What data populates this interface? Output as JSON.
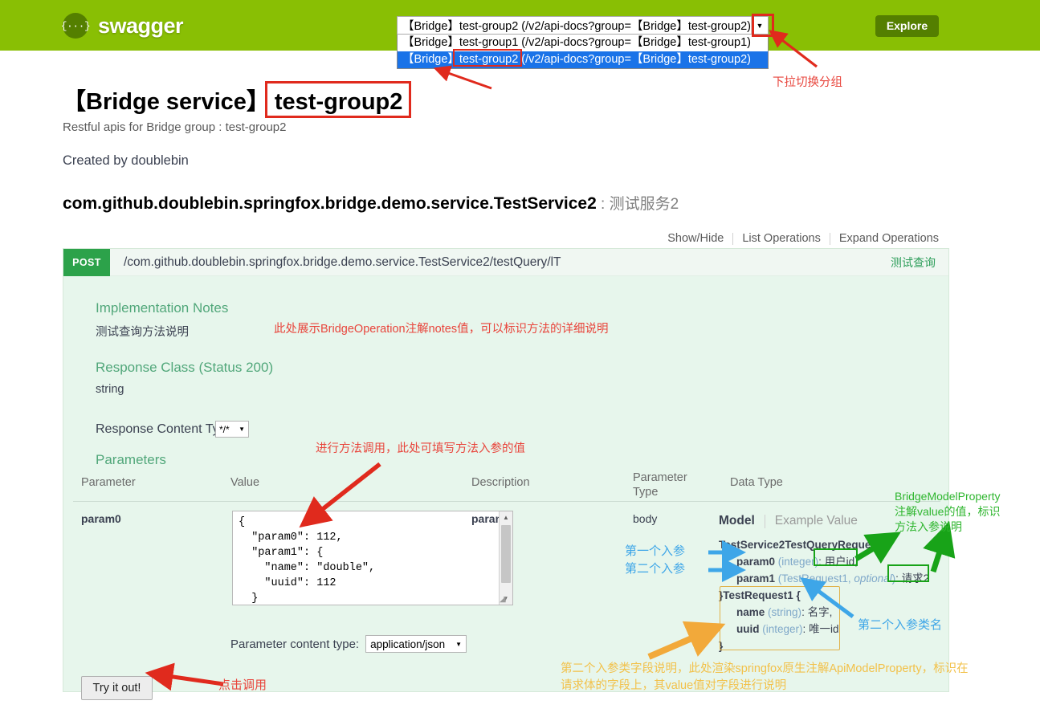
{
  "topbar": {
    "logo_text": "swagger",
    "logo_icon": "braces-icon",
    "explore_label": "Explore",
    "select_value": "【Bridge】test-group2 (/v2/api-docs?group=【Bridge】test-group2)",
    "select_arrow_icon": "chevron-down-icon",
    "options": [
      "【Bridge】test-group1 (/v2/api-docs?group=【Bridge】test-group1)",
      "【Bridge】test-group2 (/v2/api-docs?group=【Bridge】test-group2)"
    ],
    "selected_index": 1
  },
  "info": {
    "title_service": "【Bridge service】",
    "title_group": "test-group2",
    "description": "Restful apis for Bridge group : test-group2",
    "created_by": "Created by doublebin",
    "resource_name": "com.github.doublebin.springfox.bridge.demo.service.TestService2",
    "resource_cn": " : 测试服务2"
  },
  "op_options": {
    "show_hide": "Show/Hide",
    "list_operations": "List Operations",
    "expand_operations": "Expand Operations"
  },
  "operation": {
    "method": "POST",
    "path": "/com.github.doublebin.springfox.bridge.demo.service.TestService2/testQuery/lT",
    "summary": "测试查询",
    "impl_notes_title": "Implementation Notes",
    "impl_notes_text": "测试查询方法说明",
    "response_class_title": "Response Class (Status 200)",
    "response_class_text": "string",
    "response_content_type_label": "Response Content Type",
    "response_content_type_value": "*/*",
    "parameters_title": "Parameters",
    "columns": {
      "parameter": "Parameter",
      "value": "Value",
      "description": "Description",
      "parameter_type": "Parameter\nType",
      "data_type": "Data Type"
    },
    "row": {
      "parameter": "param0",
      "value": "{\n  \"param0\": 112,\n  \"param1\": {\n    \"name\": \"double\",\n    \"uuid\": 112\n  }\n}",
      "description": "param0",
      "parameter_type": "body"
    },
    "param_content_type_label": "Parameter content type:",
    "param_content_type_value": "application/json",
    "try_it_out": "Try it out!"
  },
  "model": {
    "tab_model": "Model",
    "tab_example": "Example Value",
    "class1_name": "TestService2TestQueryRequest {",
    "fields1": [
      {
        "name": "param0",
        "type": "(integer)",
        "optional": "",
        "desc": "用户id,"
      },
      {
        "name": "param1",
        "type": "(TestRequest1, ",
        "optional": "optional",
        "desc": "请求2"
      }
    ],
    "class2_name": "}TestRequest1 {",
    "fields2": [
      {
        "name": "name",
        "type": "(string)",
        "desc": "名字,"
      },
      {
        "name": "uuid",
        "type": "(integer)",
        "desc": "唯一id"
      }
    ],
    "close_brace": "}"
  },
  "annotations": {
    "dropdown_switch": "下拉切换分组",
    "notes_note": "此处展示BridgeOperation注解notes值，可以标识方法的详细说明",
    "params_note": "进行方法调用，此处可填写方法入参的值",
    "try_note": "点击调用",
    "first_param": "第一个入参",
    "second_param": "第二个入参",
    "bridge_model_note": "BridgeModelProperty\n注解value的值，标识\n方法入参说明",
    "second_class_note": "第二个入参类名",
    "field_note": "第二个入参类字段说明，此处渲染springfox原生注解ApiModelProperty，标识在\n请求体的字段上，其value值对字段进行说明"
  },
  "colors": {
    "brand_green": "#89bf04",
    "dark_green": "#547f00",
    "post_green": "#2ca24a",
    "panel_bg": "#e7f6ec",
    "accent_red": "#e8453c",
    "accent_blue": "#3ea6e8",
    "accent_orange": "#f2c14a",
    "accent_green": "#2fb62f"
  }
}
